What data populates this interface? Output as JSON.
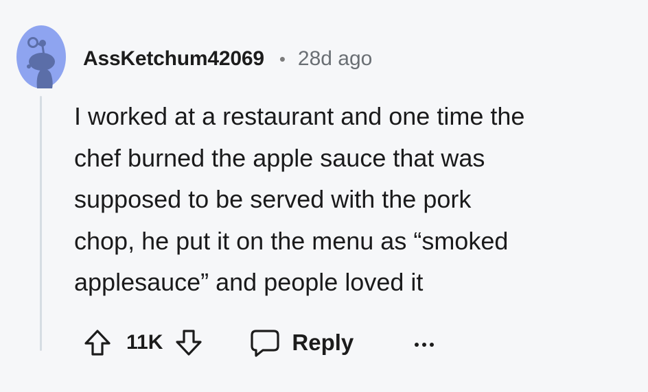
{
  "comment": {
    "author": "AssKetchum42069",
    "separator": "•",
    "time": "28d ago",
    "body_lines": [
      "I worked at a restaurant and one time the",
      "chef burned the apple sauce that was",
      "supposed to be served with the pork",
      "chop, he put it on the menu as “smoked",
      "applesauce” and people loved it"
    ],
    "score": "11K",
    "reply_label": "Reply"
  },
  "icons": {
    "avatar": "snoo-avatar-icon",
    "upvote": "upvote-arrow-icon",
    "downvote": "downvote-arrow-icon",
    "reply": "speech-bubble-icon",
    "more": "ellipsis-icon"
  },
  "colors": {
    "background": "#f6f7f9",
    "avatar_bg": "#8ea4f0",
    "avatar_figure": "#5b6ea8",
    "thread_line": "#d6dde3",
    "text": "#1a1a1b",
    "muted": "#6a6f74"
  }
}
